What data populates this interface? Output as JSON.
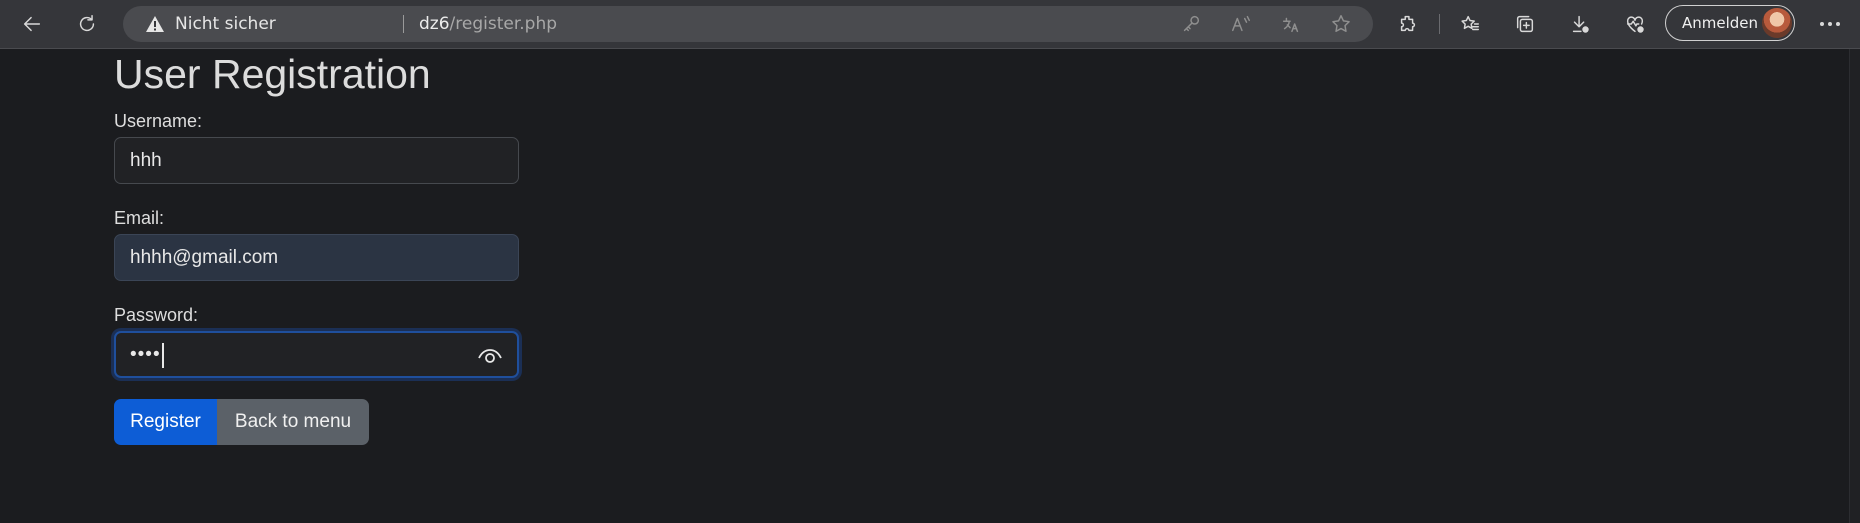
{
  "browser": {
    "security_label": "Nicht sicher",
    "url_host": "dz6",
    "url_path": "/register.php",
    "signin_label": "Anmelden"
  },
  "page": {
    "title": "User Registration",
    "form": {
      "username_label": "Username:",
      "username_value": "hhh",
      "email_label": "Email:",
      "email_value": "hhhh@gmail.com",
      "password_label": "Password:",
      "password_masked": "••••"
    },
    "buttons": {
      "register": "Register",
      "back": "Back to menu"
    }
  },
  "colors": {
    "page_bg": "#1b1c1f",
    "primary_button": "#0d5dd6",
    "secondary_button": "#5b6168",
    "focus_border": "#1f4f9c"
  },
  "icons": [
    "back-arrow-icon",
    "refresh-icon",
    "warning-icon",
    "key-icon",
    "read-aloud-icon",
    "translate-icon",
    "star-icon",
    "extensions-icon",
    "favorites-icon",
    "collections-icon",
    "downloads-icon",
    "browser-essentials-icon",
    "more-icon",
    "eye-icon"
  ]
}
